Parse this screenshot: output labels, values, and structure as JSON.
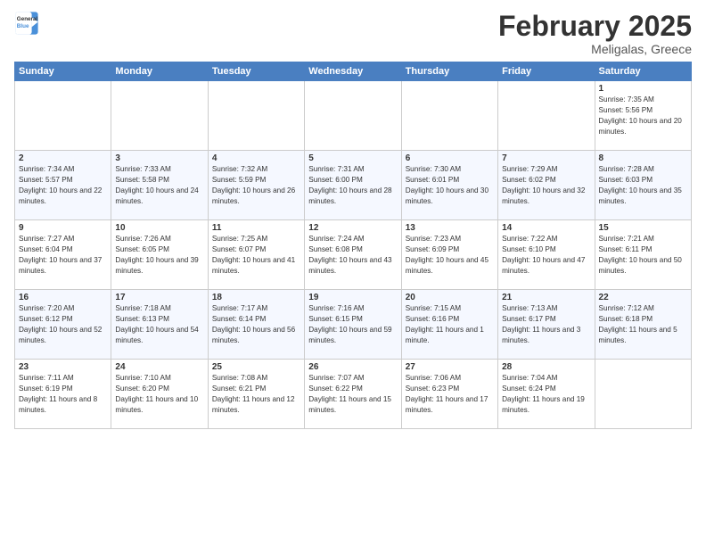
{
  "header": {
    "logo_line1": "General",
    "logo_line2": "Blue",
    "month_year": "February 2025",
    "location": "Meligalas, Greece"
  },
  "weekdays": [
    "Sunday",
    "Monday",
    "Tuesday",
    "Wednesday",
    "Thursday",
    "Friday",
    "Saturday"
  ],
  "weeks": [
    [
      {
        "day": "",
        "info": ""
      },
      {
        "day": "",
        "info": ""
      },
      {
        "day": "",
        "info": ""
      },
      {
        "day": "",
        "info": ""
      },
      {
        "day": "",
        "info": ""
      },
      {
        "day": "",
        "info": ""
      },
      {
        "day": "1",
        "info": "Sunrise: 7:35 AM\nSunset: 5:56 PM\nDaylight: 10 hours and 20 minutes."
      }
    ],
    [
      {
        "day": "2",
        "info": "Sunrise: 7:34 AM\nSunset: 5:57 PM\nDaylight: 10 hours and 22 minutes."
      },
      {
        "day": "3",
        "info": "Sunrise: 7:33 AM\nSunset: 5:58 PM\nDaylight: 10 hours and 24 minutes."
      },
      {
        "day": "4",
        "info": "Sunrise: 7:32 AM\nSunset: 5:59 PM\nDaylight: 10 hours and 26 minutes."
      },
      {
        "day": "5",
        "info": "Sunrise: 7:31 AM\nSunset: 6:00 PM\nDaylight: 10 hours and 28 minutes."
      },
      {
        "day": "6",
        "info": "Sunrise: 7:30 AM\nSunset: 6:01 PM\nDaylight: 10 hours and 30 minutes."
      },
      {
        "day": "7",
        "info": "Sunrise: 7:29 AM\nSunset: 6:02 PM\nDaylight: 10 hours and 32 minutes."
      },
      {
        "day": "8",
        "info": "Sunrise: 7:28 AM\nSunset: 6:03 PM\nDaylight: 10 hours and 35 minutes."
      }
    ],
    [
      {
        "day": "9",
        "info": "Sunrise: 7:27 AM\nSunset: 6:04 PM\nDaylight: 10 hours and 37 minutes."
      },
      {
        "day": "10",
        "info": "Sunrise: 7:26 AM\nSunset: 6:05 PM\nDaylight: 10 hours and 39 minutes."
      },
      {
        "day": "11",
        "info": "Sunrise: 7:25 AM\nSunset: 6:07 PM\nDaylight: 10 hours and 41 minutes."
      },
      {
        "day": "12",
        "info": "Sunrise: 7:24 AM\nSunset: 6:08 PM\nDaylight: 10 hours and 43 minutes."
      },
      {
        "day": "13",
        "info": "Sunrise: 7:23 AM\nSunset: 6:09 PM\nDaylight: 10 hours and 45 minutes."
      },
      {
        "day": "14",
        "info": "Sunrise: 7:22 AM\nSunset: 6:10 PM\nDaylight: 10 hours and 47 minutes."
      },
      {
        "day": "15",
        "info": "Sunrise: 7:21 AM\nSunset: 6:11 PM\nDaylight: 10 hours and 50 minutes."
      }
    ],
    [
      {
        "day": "16",
        "info": "Sunrise: 7:20 AM\nSunset: 6:12 PM\nDaylight: 10 hours and 52 minutes."
      },
      {
        "day": "17",
        "info": "Sunrise: 7:18 AM\nSunset: 6:13 PM\nDaylight: 10 hours and 54 minutes."
      },
      {
        "day": "18",
        "info": "Sunrise: 7:17 AM\nSunset: 6:14 PM\nDaylight: 10 hours and 56 minutes."
      },
      {
        "day": "19",
        "info": "Sunrise: 7:16 AM\nSunset: 6:15 PM\nDaylight: 10 hours and 59 minutes."
      },
      {
        "day": "20",
        "info": "Sunrise: 7:15 AM\nSunset: 6:16 PM\nDaylight: 11 hours and 1 minute."
      },
      {
        "day": "21",
        "info": "Sunrise: 7:13 AM\nSunset: 6:17 PM\nDaylight: 11 hours and 3 minutes."
      },
      {
        "day": "22",
        "info": "Sunrise: 7:12 AM\nSunset: 6:18 PM\nDaylight: 11 hours and 5 minutes."
      }
    ],
    [
      {
        "day": "23",
        "info": "Sunrise: 7:11 AM\nSunset: 6:19 PM\nDaylight: 11 hours and 8 minutes."
      },
      {
        "day": "24",
        "info": "Sunrise: 7:10 AM\nSunset: 6:20 PM\nDaylight: 11 hours and 10 minutes."
      },
      {
        "day": "25",
        "info": "Sunrise: 7:08 AM\nSunset: 6:21 PM\nDaylight: 11 hours and 12 minutes."
      },
      {
        "day": "26",
        "info": "Sunrise: 7:07 AM\nSunset: 6:22 PM\nDaylight: 11 hours and 15 minutes."
      },
      {
        "day": "27",
        "info": "Sunrise: 7:06 AM\nSunset: 6:23 PM\nDaylight: 11 hours and 17 minutes."
      },
      {
        "day": "28",
        "info": "Sunrise: 7:04 AM\nSunset: 6:24 PM\nDaylight: 11 hours and 19 minutes."
      },
      {
        "day": "",
        "info": ""
      }
    ]
  ]
}
